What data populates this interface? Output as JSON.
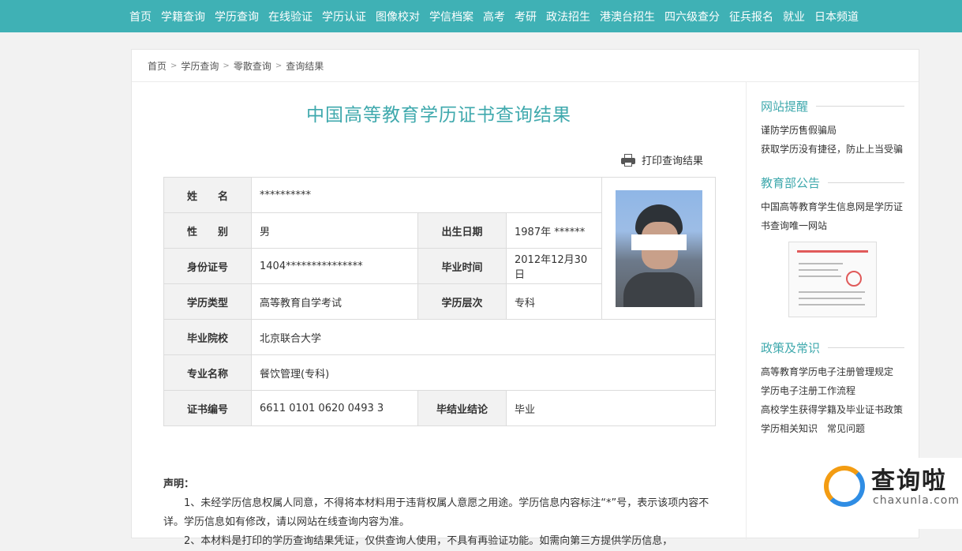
{
  "nav": [
    "首页",
    "学籍查询",
    "学历查询",
    "在线验证",
    "学历认证",
    "图像校对",
    "学信档案",
    "高考",
    "考研",
    "政法招生",
    "港澳台招生",
    "四六级查分",
    "征兵报名",
    "就业",
    "日本频道"
  ],
  "breadcrumb": [
    "首页",
    "学历查询",
    "零散查询",
    "查询结果"
  ],
  "page_title": "中国高等教育学历证书查询结果",
  "print_label": "打印查询结果",
  "fields": {
    "name_label": "姓　　名",
    "name_value": "**********",
    "gender_label": "性　　别",
    "gender_value": "男",
    "birth_label": "出生日期",
    "birth_value": "1987年 ******",
    "id_label": "身份证号",
    "id_value": "1404***************",
    "grad_time_label": "毕业时间",
    "grad_time_value": "2012年12月30日",
    "type_label": "学历类型",
    "type_value": "高等教育自学考试",
    "level_label": "学历层次",
    "level_value": "专科",
    "school_label": "毕业院校",
    "school_value": "北京联合大学",
    "major_label": "专业名称",
    "major_value": "餐饮管理(专科)",
    "cert_label": "证书编号",
    "cert_value": "6611 0101 0620 0493 3",
    "result_label": "毕结业结论",
    "result_value": "毕业"
  },
  "declaration": {
    "heading": "声明：",
    "p1": "1、未经学历信息权属人同意，不得将本材料用于违背权属人意愿之用途。学历信息内容标注“*”号，表示该项内容不详。学历信息如有修改，请以网站在线查询内容为准。",
    "p2": "2、本材料是打印的学历查询结果凭证，仅供查询人使用，不具有再验证功能。如需向第三方提供学历信息，"
  },
  "sidebar": {
    "sec1_title": "网站提醒",
    "sec1_links": [
      "谨防学历售假骗局",
      "获取学历没有捷径，防止上当受骗"
    ],
    "sec2_title": "教育部公告",
    "sec2_links": [
      "中国高等教育学生信息网是学历证",
      "书查询唯一网站"
    ],
    "sec3_title": "政策及常识",
    "sec3_links": [
      "高等教育学历电子注册管理规定",
      "学历电子注册工作流程",
      "高校学生获得学籍及毕业证书政策",
      "学历相关知识　常见问题"
    ]
  },
  "watermark": {
    "text": "查询啦",
    "domain": "chaxunla.com"
  },
  "colors": {
    "nav_bg": "#3fb1b5",
    "accent": "#3fa9ad"
  }
}
